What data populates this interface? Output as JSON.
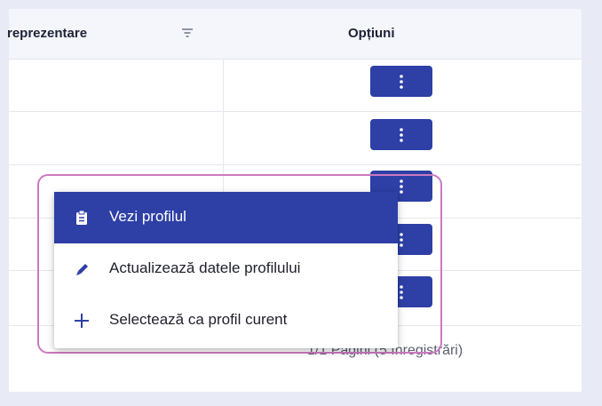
{
  "table": {
    "headers": {
      "reprezentare": "reprezentare",
      "optiuni": "Opțiuni"
    },
    "rows": [
      {
        "options_icon": "vertical-dots-icon"
      },
      {
        "options_icon": "vertical-dots-icon"
      },
      {
        "options_icon": "vertical-dots-icon"
      },
      {
        "options_icon": "vertical-dots-icon"
      },
      {
        "options_icon": "vertical-dots-icon"
      }
    ],
    "pagination": "1/1 Pagini (5 înregistrări)"
  },
  "context_menu": {
    "items": [
      {
        "label": "Vezi profilul",
        "icon": "clipboard-icon",
        "active": true
      },
      {
        "label": "Actualizează datele profilului",
        "icon": "pencil-icon",
        "active": false
      },
      {
        "label": "Selectează ca profil curent",
        "icon": "plus-icon",
        "active": false
      }
    ]
  },
  "colors": {
    "primary": "#2e3fa6",
    "highlight_outline": "#cc79c0",
    "header_bg": "#f4f6fb",
    "page_bg": "#e8eaf6"
  }
}
